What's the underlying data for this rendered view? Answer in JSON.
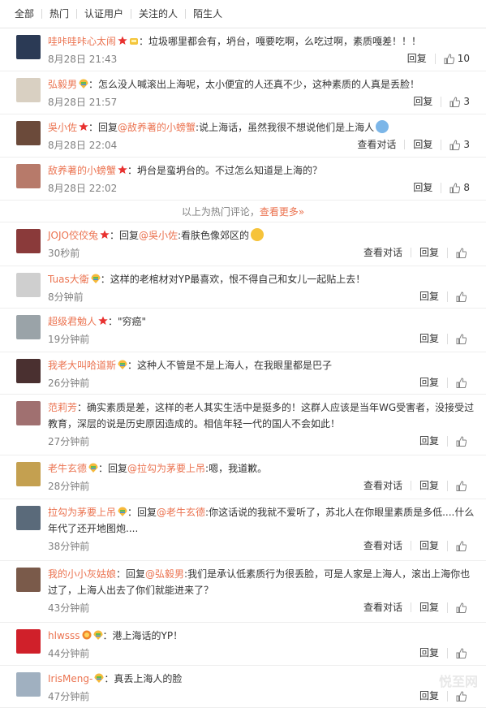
{
  "tabs": [
    "全部",
    "热门",
    "认证用户",
    "关注的人",
    "陌生人"
  ],
  "hot_divider": {
    "text": "以上为热门评论，",
    "link": "查看更多»"
  },
  "ui": {
    "reply": "回复",
    "view_thread": "查看对话"
  },
  "colors": {
    "accent": "#eb7350",
    "gray": "#808080"
  },
  "comments": [
    {
      "user": "哇咔哇咔心太闹",
      "badges": [
        "star",
        "yellow-crown"
      ],
      "text": "：垃圾哪里都会有，坍台，嘎要吃啊，么吃过啊，素质嘎差！！！",
      "time": "8月28日 21:43",
      "reply": "回复",
      "likes": "10"
    },
    {
      "user": "弘毅男",
      "badges": [
        "rainbow"
      ],
      "text": "：怎么没人喊滚出上海呢，太小便宜的人还真不少，这种素质的人真是丢脸！",
      "time": "8月28日 21:57",
      "reply": "回复",
      "likes": "3"
    },
    {
      "user": "吳小佐",
      "badges": [
        "star"
      ],
      "pre": "：回复",
      "at": "@敌养著的小螃蟹",
      "text": ":说上海话，虽然我很不想说他们是上海人",
      "emoji": "sweat",
      "time": "8月28日 22:04",
      "thread": "查看对话",
      "reply": "回复",
      "likes": "3"
    },
    {
      "user": "敌养著的小螃蟹",
      "badges": [
        "star"
      ],
      "text": "：坍台是蛮坍台的。不过怎么知道是上海的？",
      "time": "8月28日 22:02",
      "reply": "回复",
      "likes": "8"
    },
    {
      "user": "JOJO佼佼兔",
      "badges": [
        "star"
      ],
      "pre": "：回复",
      "at": "@吳小佐",
      "text": ":看肤色像郊区的",
      "emoji": "laugh",
      "time": "30秒前",
      "thread": "查看对话",
      "reply": "回复",
      "likes": ""
    },
    {
      "user": "Tuas大衛",
      "badges": [
        "rainbow"
      ],
      "text": "：这样的老棺材对YP最喜欢，恨不得自己和女儿一起贴上去！",
      "time": "8分钟前",
      "reply": "回复",
      "likes": ""
    },
    {
      "user": "超级君勉人",
      "badges": [
        "star"
      ],
      "text": "：\"穷癌\"",
      "time": "19分钟前",
      "reply": "回复",
      "likes": ""
    },
    {
      "user": "我老大叫哈道斯",
      "badges": [
        "rainbow"
      ],
      "text": "：这种人不管是不是上海人，在我眼里都是巴子",
      "time": "26分钟前",
      "reply": "回复",
      "likes": ""
    },
    {
      "user": "范莉芳",
      "badges": [],
      "text": "：确实素质是差，这样的老人其实生活中是挺多的！这群人应该是当年WG受害者，没接受过教育，深层的说是历史原因造成的。相信年轻一代的国人不会如此！",
      "time": "27分钟前",
      "reply": "回复",
      "likes": ""
    },
    {
      "user": "老牛玄德",
      "badges": [
        "rainbow"
      ],
      "pre": "：回复",
      "at": "@拉勾为茅要上吊",
      "text": ":嗯，我道歉。",
      "time": "28分钟前",
      "thread": "查看对话",
      "reply": "回复",
      "likes": ""
    },
    {
      "user": "拉勾为茅要上吊",
      "badges": [
        "rainbow"
      ],
      "pre": "：回复",
      "at": "@老牛玄德",
      "text": ":你这话说的我就不爱听了，苏北人在你眼里素质是多低....什么年代了还开地图炮....",
      "time": "38分钟前",
      "thread": "查看对话",
      "reply": "回复",
      "likes": ""
    },
    {
      "user": "我的小小灰姑娘",
      "badges": [],
      "pre": "：回复",
      "at": "@弘毅男",
      "text": ":我们是承认低素质行为很丢脸，可是人家是上海人，滚出上海你也过了，上海人出去了你们就能进来了？",
      "time": "43分钟前",
      "thread": "查看对话",
      "reply": "回复",
      "likes": ""
    },
    {
      "user": "hlwsss",
      "badges": [
        "vip",
        "rainbow"
      ],
      "text": "：港上海话的YP！",
      "time": "44分钟前",
      "reply": "回复",
      "likes": ""
    },
    {
      "user": "IrisMeng-",
      "badges": [
        "rainbow"
      ],
      "text": "：真丢上海人的脸",
      "time": "47分钟前",
      "reply": "回复",
      "likes": ""
    }
  ],
  "watermark": "悦至网"
}
